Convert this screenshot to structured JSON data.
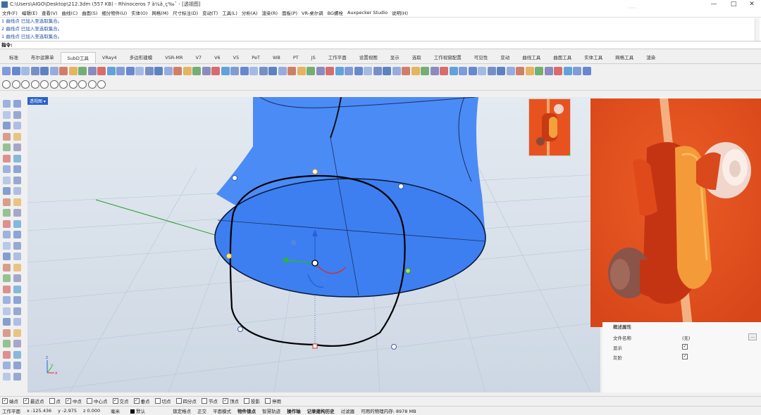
{
  "window": {
    "title": "C:\\Users\\AIGO\\Desktop\\212.3dm (557 KB) - Rhinoceros 7 ä¼ä¸ç‰ˆ - [透视图]"
  },
  "menu": [
    "文件(F)",
    "编辑(E)",
    "查看(V)",
    "曲线(C)",
    "曲面(S)",
    "细分物件(U)",
    "实体(O)",
    "网格(M)",
    "尺寸标注(D)",
    "变动(T)",
    "工具(L)",
    "分析(A)",
    "渲染(R)",
    "面板(P)",
    "VR-桌尔调",
    "BG螺栓",
    "Auxpecker Studio",
    "说明(H)"
  ],
  "command_history": [
    "1 曲线点 已加入至选取集合。",
    "2 曲线点 已加入至选取集合。",
    "1 曲线点 已加入至选取集合。"
  ],
  "command_prompt": "指令:",
  "tabs": [
    "标准",
    "布尔运算单",
    "SubD工具",
    "VRay4",
    "多边形建模",
    "VSR-MR",
    "V7",
    "V6",
    "V5",
    "PeT",
    "WB",
    "PT",
    "JS",
    "工作平面",
    "设置视图",
    "显示",
    "选取",
    "工作视窗配置",
    "可见性",
    "变动",
    "曲线工具",
    "曲面工具",
    "实体工具",
    "网格工具",
    "渲染"
  ],
  "active_tab": "SubD工具",
  "viewport": {
    "label": "透视图"
  },
  "properties": {
    "section_label": "概述属性",
    "rows": [
      {
        "label": "文件名称",
        "value": "(无)"
      },
      {
        "label": "显示",
        "checked": "✓"
      },
      {
        "label": "灰阶",
        "checked": "✓"
      }
    ]
  },
  "osnap": [
    {
      "label": "端点",
      "checked": "✓"
    },
    {
      "label": "最近点",
      "checked": "✓"
    },
    {
      "label": "点",
      "checked": ""
    },
    {
      "label": "中点",
      "checked": "✓"
    },
    {
      "label": "中心点",
      "checked": ""
    },
    {
      "label": "交点",
      "checked": "✓"
    },
    {
      "label": "垂点",
      "checked": "✓"
    },
    {
      "label": "切点",
      "checked": ""
    },
    {
      "label": "四分点",
      "checked": ""
    },
    {
      "label": "节点",
      "checked": ""
    },
    {
      "label": "顶点",
      "checked": "✓"
    },
    {
      "label": "投影",
      "checked": ""
    },
    {
      "label": "停用",
      "checked": ""
    }
  ],
  "status": {
    "cplane": "工作平面",
    "x": "x -125.436",
    "y": "y -2.975",
    "z": "z 0.000",
    "unit": "毫米",
    "layer": "默认",
    "items": [
      "锁定格点",
      "正交",
      "平面模式",
      "物件锁点",
      "智慧轨迹",
      "操作轴",
      "记录建构历史",
      "过滤器"
    ],
    "memory": "可用的物理内存: 8978 MB"
  },
  "colors": {
    "surface_blue": "#3d7ff0",
    "photo_orange": "#e8521f",
    "viewport_bg": "#d6dee8"
  }
}
